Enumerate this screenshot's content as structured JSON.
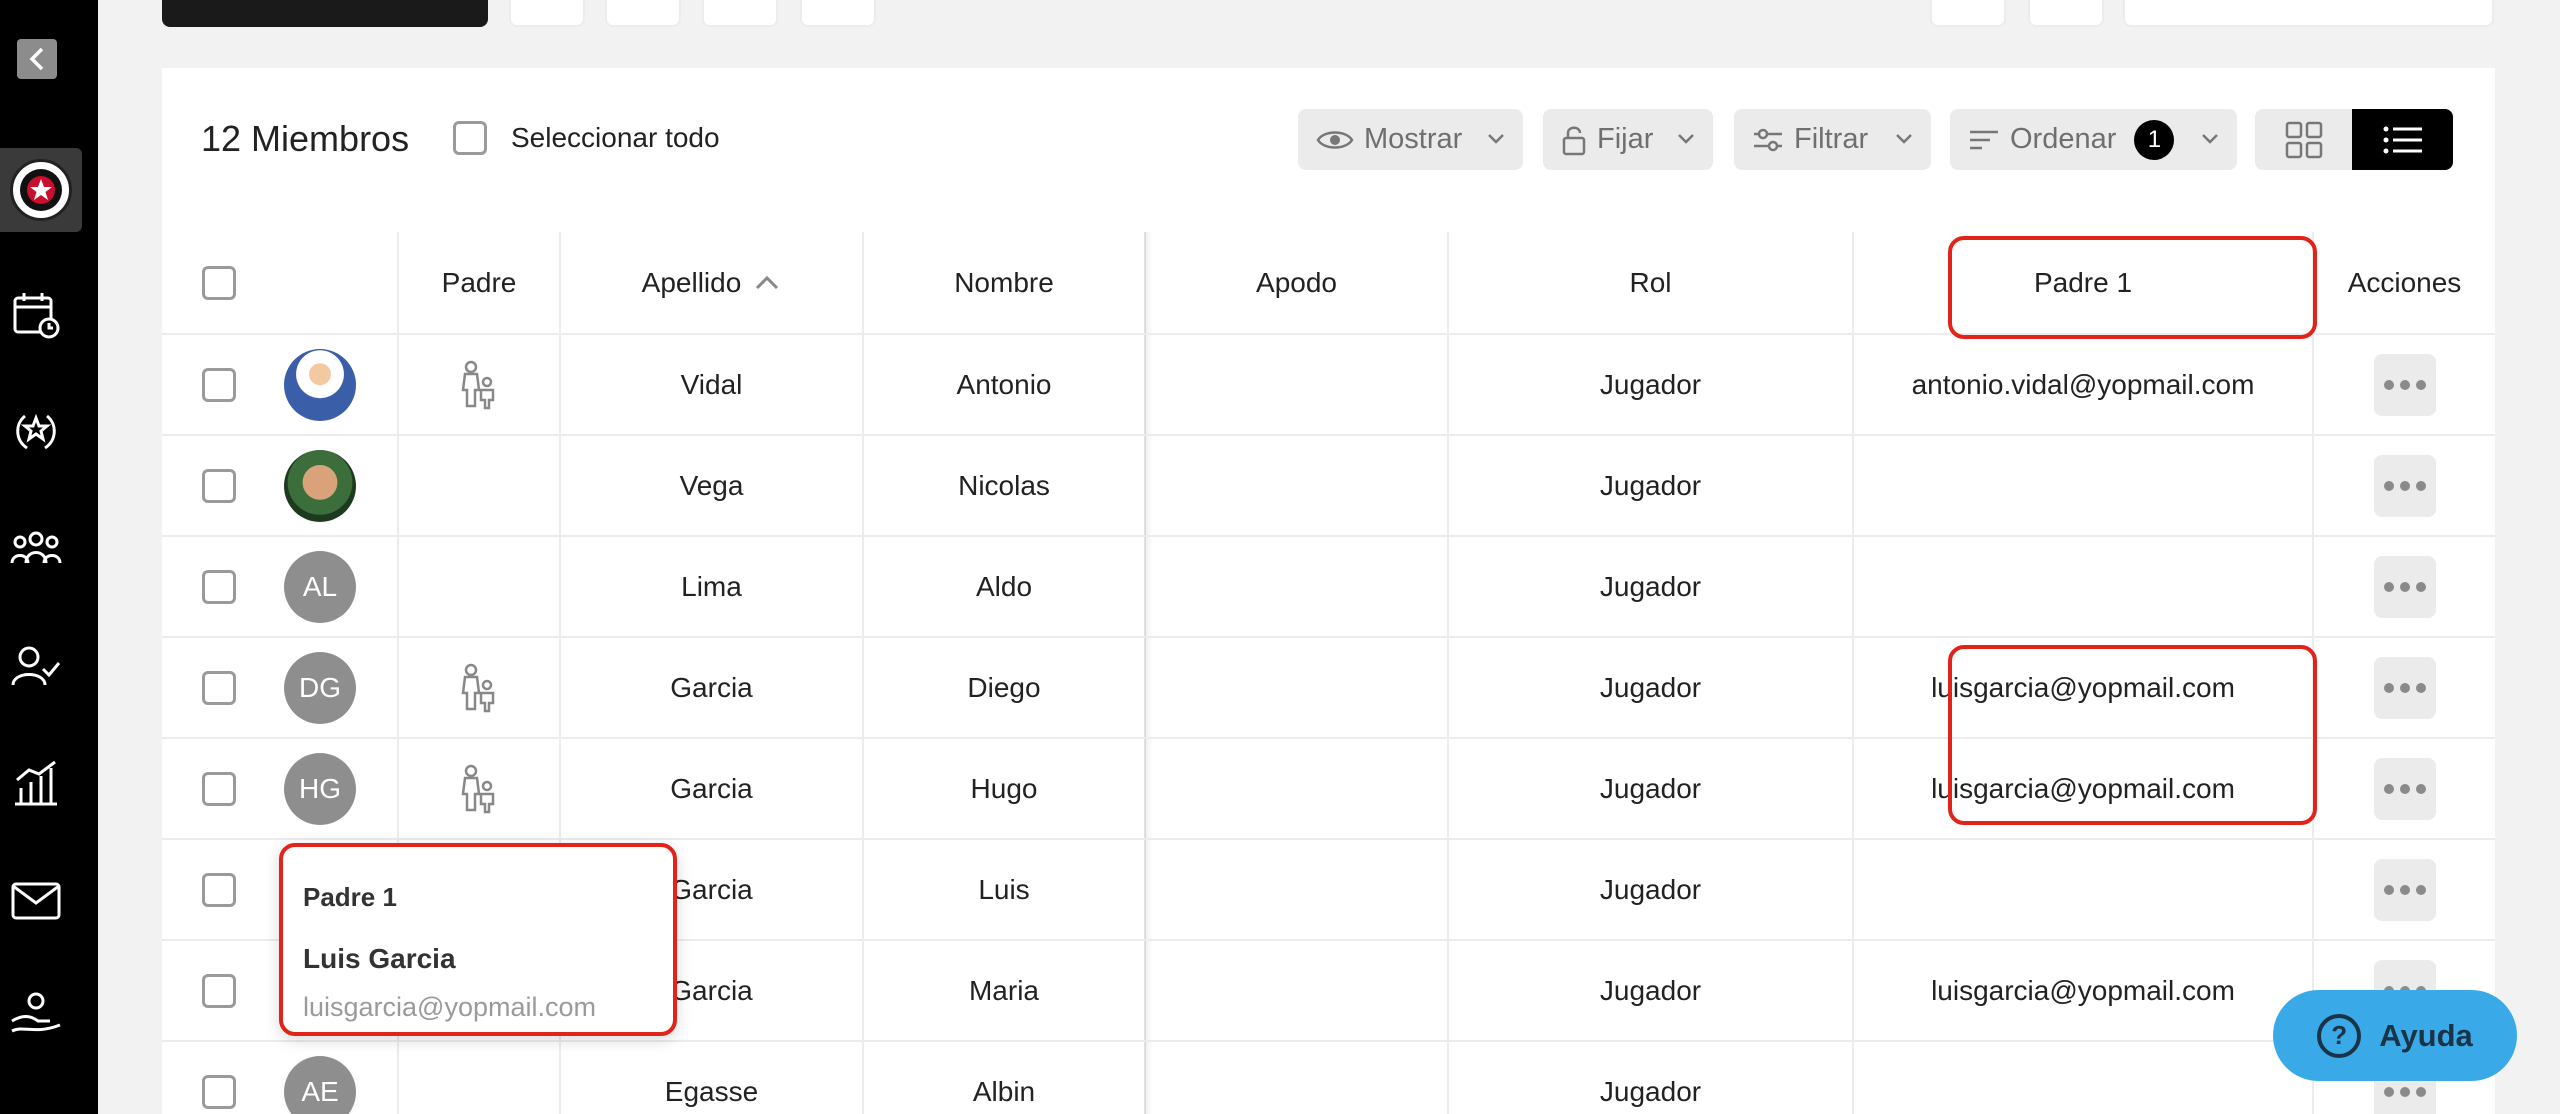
{
  "sidebar": {
    "items": [
      {
        "icon": "calendar-clock-icon"
      },
      {
        "icon": "laurel-trophy-icon"
      },
      {
        "icon": "team-group-icon"
      },
      {
        "icon": "user-check-icon"
      },
      {
        "icon": "stats-chart-icon"
      },
      {
        "icon": "mail-icon"
      },
      {
        "icon": "hand-payment-icon"
      }
    ]
  },
  "header": {
    "count_label": "12 Miembros",
    "select_all_label": "Seleccionar todo",
    "buttons": {
      "show": "Mostrar",
      "pin": "Fijar",
      "filter": "Filtrar",
      "sort": "Ordenar",
      "sort_badge": "1"
    }
  },
  "table": {
    "columns": {
      "parent": "Padre",
      "last_name": "Apellido",
      "first_name": "Nombre",
      "nickname": "Apodo",
      "role": "Rol",
      "parent1": "Padre 1",
      "actions": "Acciones"
    },
    "rows": [
      {
        "avatar": "",
        "is_parent": true,
        "last_name": "Vidal",
        "first_name": "Antonio",
        "nickname": "",
        "role": "Jugador",
        "parent1": "antonio.vidal@yopmail.com"
      },
      {
        "avatar": "",
        "is_parent": false,
        "last_name": "Vega",
        "first_name": "Nicolas",
        "nickname": "",
        "role": "Jugador",
        "parent1": ""
      },
      {
        "avatar": "AL",
        "is_parent": false,
        "last_name": "Lima",
        "first_name": "Aldo",
        "nickname": "",
        "role": "Jugador",
        "parent1": ""
      },
      {
        "avatar": "DG",
        "is_parent": true,
        "last_name": "Garcia",
        "first_name": "Diego",
        "nickname": "",
        "role": "Jugador",
        "parent1": "luisgarcia@yopmail.com"
      },
      {
        "avatar": "HG",
        "is_parent": true,
        "last_name": "Garcia",
        "first_name": "Hugo",
        "nickname": "",
        "role": "Jugador",
        "parent1": "luisgarcia@yopmail.com"
      },
      {
        "avatar": "",
        "is_parent": false,
        "last_name": "Garcia",
        "first_name": "Luis",
        "nickname": "",
        "role": "Jugador",
        "parent1": ""
      },
      {
        "avatar": "",
        "is_parent": false,
        "last_name": "Garcia",
        "first_name": "Maria",
        "nickname": "",
        "role": "Jugador",
        "parent1": "luisgarcia@yopmail.com"
      },
      {
        "avatar": "AE",
        "is_parent": false,
        "last_name": "Egasse",
        "first_name": "Albin",
        "nickname": "",
        "role": "Jugador",
        "parent1": ""
      }
    ]
  },
  "popup": {
    "title": "Padre 1",
    "name": "Luis Garcia",
    "email": "luisgarcia@yopmail.com"
  },
  "help": {
    "label": "Ayuda"
  },
  "colors": {
    "highlight": "#e2231a",
    "help": "#3aa9e8"
  }
}
